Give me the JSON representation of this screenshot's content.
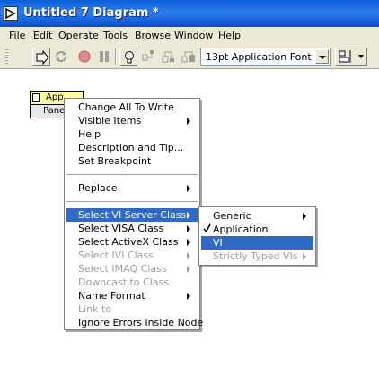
{
  "window": {
    "title": "Untitled 7 Diagram *"
  },
  "menubar": {
    "items": [
      "File",
      "Edit",
      "Operate",
      "Tools",
      "Browse",
      "Window",
      "Help"
    ]
  },
  "toolbar": {
    "buttons": [
      "run-arrow-icon",
      "run-continuously-icon",
      "abort-icon",
      "pause-icon",
      "highlight-execution-icon",
      "retain-wire-values-icon",
      "step-into-icon",
      "step-over-icon",
      "step-out-icon"
    ],
    "font_value": "13pt Application Font",
    "align_icon": "align-objects-icon"
  },
  "node": {
    "top_label": "App",
    "bottom_label": "Panel"
  },
  "context_menu": {
    "items": [
      {
        "label": "Change All To Write",
        "submenu": false,
        "disabled": false
      },
      {
        "label": "Visible Items",
        "submenu": true,
        "disabled": false
      },
      {
        "label": "Help",
        "submenu": false,
        "disabled": false
      },
      {
        "label": "Description and Tip...",
        "submenu": false,
        "disabled": false
      },
      {
        "label": "Set Breakpoint",
        "submenu": false,
        "disabled": false
      },
      {
        "label": "Replace",
        "submenu": true,
        "disabled": false
      },
      {
        "label": "Select VI Server Class",
        "submenu": true,
        "disabled": false,
        "selected": true
      },
      {
        "label": "Select VISA Class",
        "submenu": true,
        "disabled": false
      },
      {
        "label": "Select ActiveX Class",
        "submenu": true,
        "disabled": false
      },
      {
        "label": "Select IVI Class",
        "submenu": true,
        "disabled": true
      },
      {
        "label": "Select IMAQ Class",
        "submenu": true,
        "disabled": true
      },
      {
        "label": "Downcast to Class",
        "submenu": false,
        "disabled": true
      },
      {
        "label": "Name Format",
        "submenu": true,
        "disabled": false
      },
      {
        "label": "Link to",
        "submenu": false,
        "disabled": true
      },
      {
        "label": "Ignore Errors inside Node",
        "submenu": false,
        "disabled": false
      }
    ]
  },
  "submenu": {
    "items": [
      {
        "label": "Generic",
        "submenu": true,
        "disabled": false,
        "checked": false
      },
      {
        "label": "Application",
        "submenu": false,
        "disabled": false,
        "checked": true
      },
      {
        "label": "VI",
        "submenu": false,
        "disabled": false,
        "checked": false,
        "selected": true
      },
      {
        "label": "Strictly Typed VIs",
        "submenu": true,
        "disabled": true,
        "checked": false
      }
    ]
  },
  "colors": {
    "titlebar": "#0a5fd8",
    "highlight": "#316ac5",
    "chrome": "#ece9d8",
    "node_fill": "#ffffa8"
  }
}
